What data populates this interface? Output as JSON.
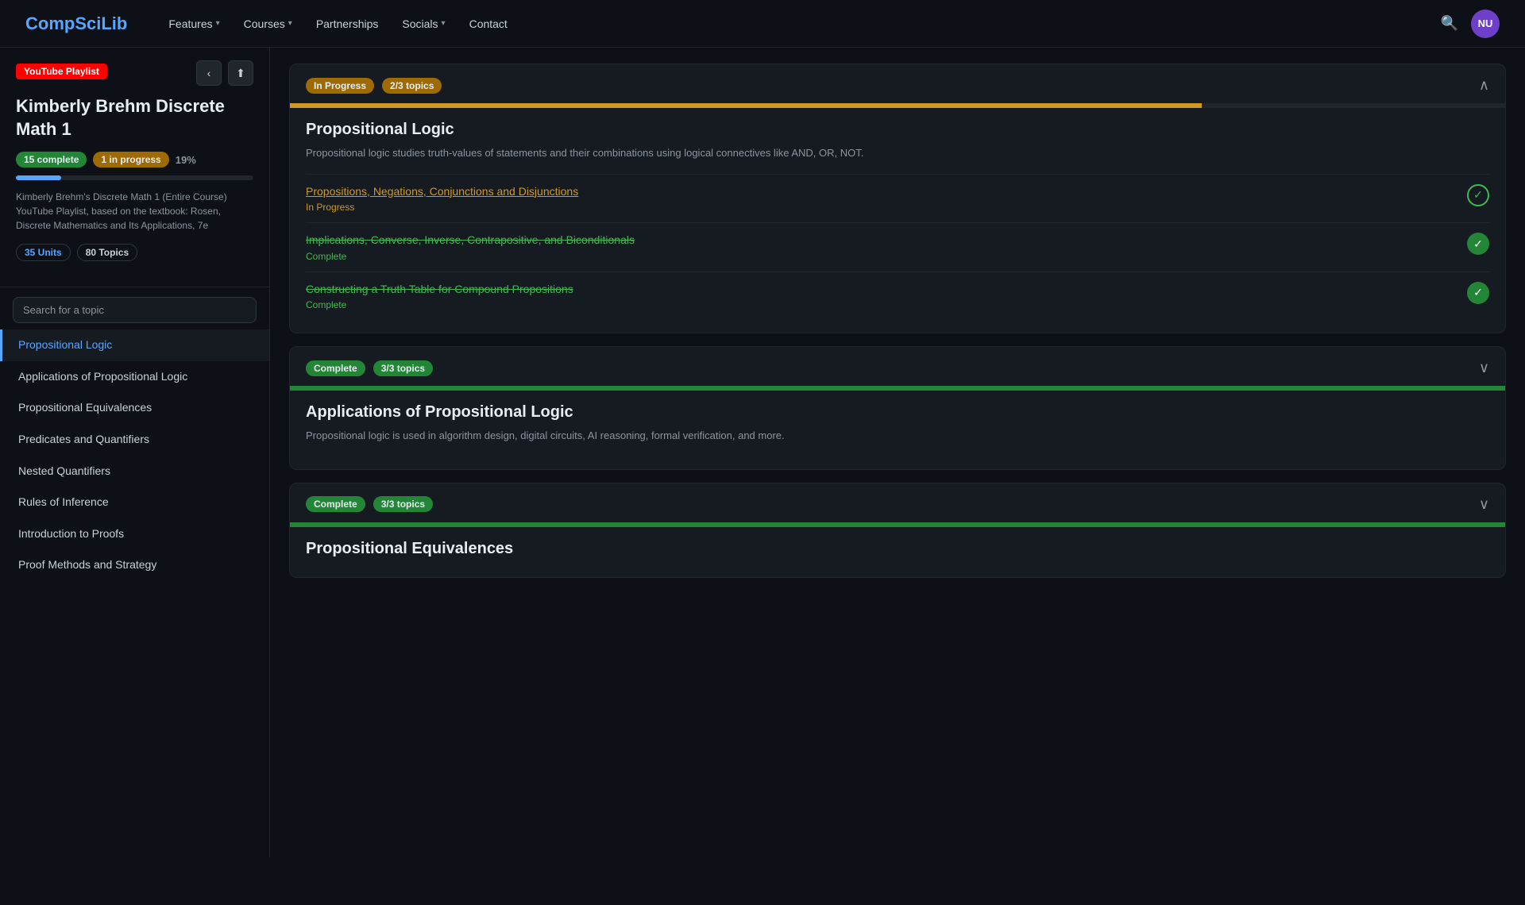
{
  "nav": {
    "logo_text": "CompSciLib",
    "logo_highlight": "Sci",
    "items": [
      {
        "label": "Features",
        "has_dropdown": true
      },
      {
        "label": "Courses",
        "has_dropdown": true
      },
      {
        "label": "Partnerships",
        "has_dropdown": false
      },
      {
        "label": "Socials",
        "has_dropdown": true
      },
      {
        "label": "Contact",
        "has_dropdown": false
      }
    ],
    "avatar_initials": "NU"
  },
  "sidebar": {
    "yt_badge": "YouTube Playlist",
    "back_arrow": "‹",
    "share_icon": "⬆",
    "course_title": "Kimberly Brehm Discrete Math 1",
    "stats": {
      "complete_count": "15 complete",
      "in_progress_count": "1 in progress",
      "pct": "19%",
      "progress_width": "19%"
    },
    "description": "Kimberly Brehm's Discrete Math 1 (Entire Course) YouTube Playlist, based on the textbook: Rosen, Discrete Mathematics and Its Applications, 7e",
    "units_badge": "35 Units",
    "topics_badge": "80 Topics",
    "search_placeholder": "Search for a topic",
    "nav_items": [
      {
        "label": "Propositional Logic",
        "active": true
      },
      {
        "label": "Applications of Propositional Logic",
        "active": false
      },
      {
        "label": "Propositional Equivalences",
        "active": false
      },
      {
        "label": "Predicates and Quantifiers",
        "active": false
      },
      {
        "label": "Nested Quantifiers",
        "active": false
      },
      {
        "label": "Rules of Inference",
        "active": false
      },
      {
        "label": "Introduction to Proofs",
        "active": false
      },
      {
        "label": "Proof Methods and Strategy",
        "active": false
      }
    ]
  },
  "main": {
    "cards": [
      {
        "id": "propositional-logic",
        "status": "In Progress",
        "status_type": "in-progress",
        "topics_label": "2/3 topics",
        "progress_pct": 75,
        "title": "Propositional Logic",
        "description": "Propositional logic studies truth-values of statements and their combinations using logical connectives like AND, OR, NOT.",
        "collapsed": false,
        "topics": [
          {
            "name": "Propositions, Negations, Conjunctions and Disjunctions",
            "status": "In Progress",
            "status_type": "in-progress",
            "check_type": "outline"
          },
          {
            "name": "Implications, Converse, Inverse, Contrapositive, and Biconditionals",
            "status": "Complete",
            "status_type": "complete",
            "check_type": "filled"
          },
          {
            "name": "Constructing a Truth Table for Compound Propositions",
            "status": "Complete",
            "status_type": "complete",
            "check_type": "filled"
          }
        ]
      },
      {
        "id": "applications-propositional-logic",
        "status": "Complete",
        "status_type": "complete",
        "topics_label": "3/3 topics",
        "progress_pct": 100,
        "title": "Applications of Propositional Logic",
        "description": "Propositional logic is used in algorithm design, digital circuits, AI reasoning, formal verification, and more.",
        "collapsed": true,
        "topics": []
      },
      {
        "id": "propositional-equivalences",
        "status": "Complete",
        "status_type": "complete",
        "topics_label": "3/3 topics",
        "progress_pct": 100,
        "title": "Propositional Equivalences",
        "description": "",
        "collapsed": true,
        "topics": []
      }
    ]
  }
}
